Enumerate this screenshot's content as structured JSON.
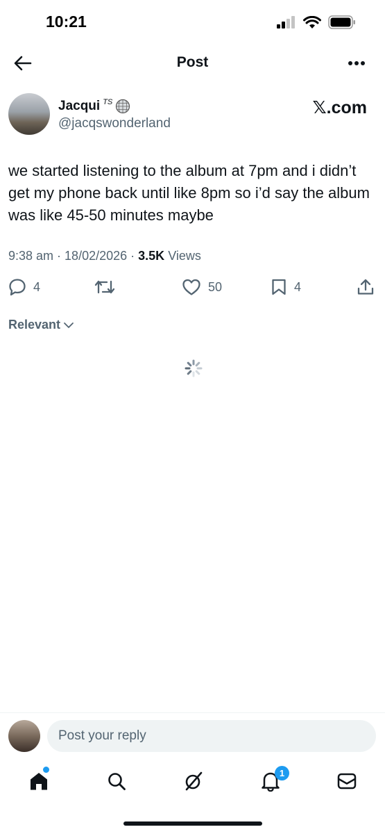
{
  "status_bar": {
    "time": "10:21",
    "signal_icon": "cellular-signal-icon",
    "wifi_icon": "wifi-icon",
    "battery_icon": "battery-icon"
  },
  "header": {
    "title": "Post",
    "back_icon": "arrow-left-icon",
    "more_icon": "more-horizontal-icon"
  },
  "author": {
    "name": "Jacqui",
    "name_suffix": "TS",
    "handle": "@jacqswonderland"
  },
  "source_label": "𝕏.com",
  "post": {
    "text": "we started listening to the album at 7pm and i didn’t get my phone back until like 8pm so i’d say the album was like 45-50 minutes maybe",
    "time": "9:38 am",
    "date": "18/02/2026",
    "views_count": "3.5K",
    "views_label": "Views"
  },
  "actions": {
    "replies": "4",
    "reposts": "",
    "likes": "50",
    "bookmarks": "4"
  },
  "sort": {
    "label": "Relevant"
  },
  "reply_bar": {
    "placeholder": "Post your reply"
  },
  "bottom_nav": {
    "items": [
      "home-icon",
      "search-icon",
      "grok-icon",
      "notifications-icon",
      "messages-icon"
    ],
    "notification_badge": "1"
  },
  "colors": {
    "accent": "#1d9bf0",
    "text": "#0f1419",
    "secondary": "#536471"
  }
}
